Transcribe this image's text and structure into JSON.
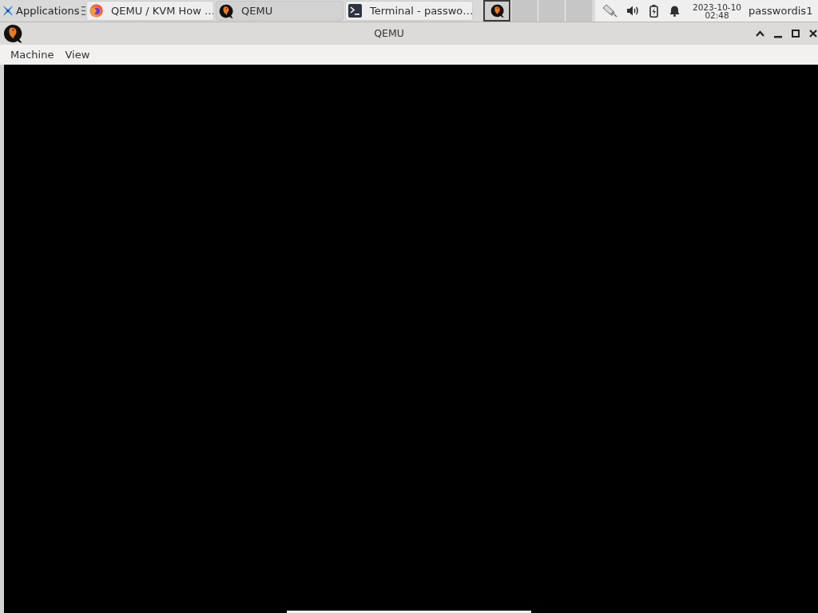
{
  "panel": {
    "applications_menu": {
      "label": "Applications"
    },
    "tasks": [
      {
        "kind": "browser",
        "label": "QEMU / KVM How …",
        "selected": false
      },
      {
        "kind": "qemu",
        "label": "QEMU",
        "selected": true
      },
      {
        "kind": "terminal",
        "label": "Terminal - passwo…",
        "selected": false
      }
    ],
    "workspaces": [
      {
        "kind": "qemu",
        "selected": true
      },
      {
        "kind": "empty",
        "selected": false
      },
      {
        "kind": "empty",
        "selected": false
      },
      {
        "kind": "empty",
        "selected": false
      }
    ],
    "clock": {
      "date": "2023-10-10",
      "time": "02:48"
    },
    "user": "passwordis1"
  },
  "window": {
    "title": "QEMU",
    "menu": [
      {
        "label": "Machine"
      },
      {
        "label": "View"
      }
    ]
  }
}
